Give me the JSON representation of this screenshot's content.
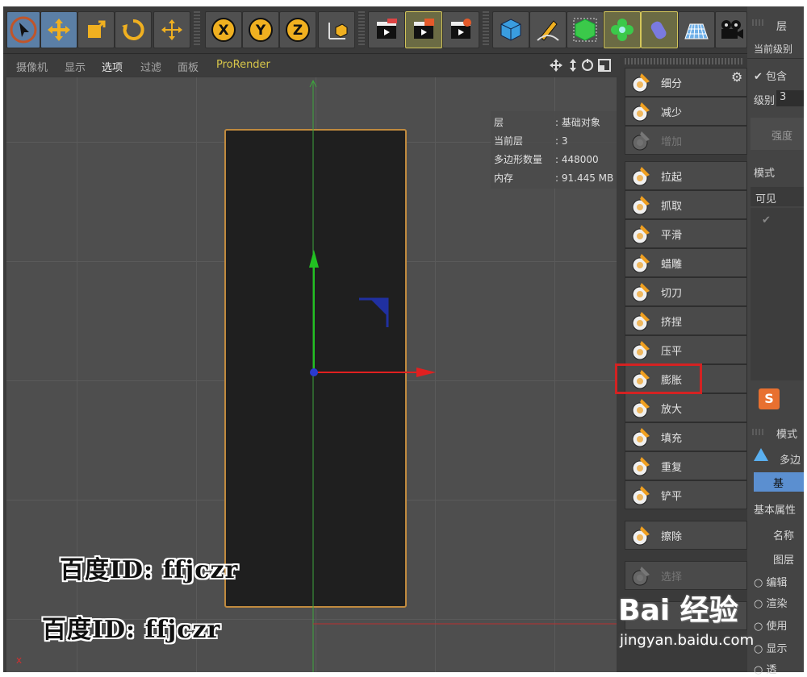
{
  "viewport_menu": {
    "items": [
      "摄像机",
      "显示",
      "选项",
      "过滤",
      "面板",
      "ProRender"
    ]
  },
  "info_overlay": [
    {
      "key": "层",
      "value": ": 基础对象"
    },
    {
      "key": "当前层",
      "value": ": 3"
    },
    {
      "key": "多边形数量",
      "value": ": 448000"
    },
    {
      "key": "内存",
      "value": ": 91.445 MB"
    }
  ],
  "brush_panel": {
    "top_buttons": [
      {
        "label": "细分",
        "icon": "subdivide-icon",
        "disabled": false
      },
      {
        "label": "减少",
        "icon": "decrease-icon",
        "disabled": false
      },
      {
        "label": "增加",
        "icon": "increase-icon",
        "disabled": true
      }
    ],
    "brushes": [
      {
        "label": "拉起",
        "icon": "pull-brush-icon"
      },
      {
        "label": "抓取",
        "icon": "grab-brush-icon"
      },
      {
        "label": "平滑",
        "icon": "smooth-brush-icon"
      },
      {
        "label": "蜡雕",
        "icon": "wax-brush-icon"
      },
      {
        "label": "切刀",
        "icon": "knife-brush-icon"
      },
      {
        "label": "挤捏",
        "icon": "pinch-brush-icon"
      },
      {
        "label": "压平",
        "icon": "flatten-brush-icon"
      },
      {
        "label": "膨胀",
        "icon": "inflate-brush-icon"
      },
      {
        "label": "放大",
        "icon": "magnify-brush-icon"
      },
      {
        "label": "填充",
        "icon": "fill-brush-icon"
      },
      {
        "label": "重复",
        "icon": "repeat-brush-icon"
      },
      {
        "label": "铲平",
        "icon": "scrape-brush-icon"
      }
    ],
    "erase": {
      "label": "擦除",
      "icon": "erase-brush-icon"
    },
    "select": {
      "label": "选择",
      "icon": "select-brush-icon"
    }
  },
  "right_panel": {
    "header": "层",
    "current_level": "当前级别",
    "include_label": "包含",
    "level_label": "级别",
    "level_value": "3",
    "strength_label": "强度",
    "mode_label": "模式",
    "visible_label": "可见",
    "mode2_label": "模式",
    "polygon_label": "多边",
    "tab_label": "基",
    "basic_props": "基本属性",
    "name_label": "名称",
    "layer_label": "图层",
    "edit_label": "编辑",
    "render_label": "渲染",
    "use_label": "使用",
    "display_label": "显示",
    "x_label": "透"
  },
  "watermarks": [
    "百度ID: ffjczr",
    "百度ID: ffjczr"
  ],
  "baidu": {
    "brand": "Bai 经验",
    "url": "jingyan.baidu.com"
  },
  "axis_mark": "x",
  "colors": {
    "highlight": "#d42222",
    "accent_yellow": "#d8c74a",
    "object_border": "#c08a3e"
  }
}
